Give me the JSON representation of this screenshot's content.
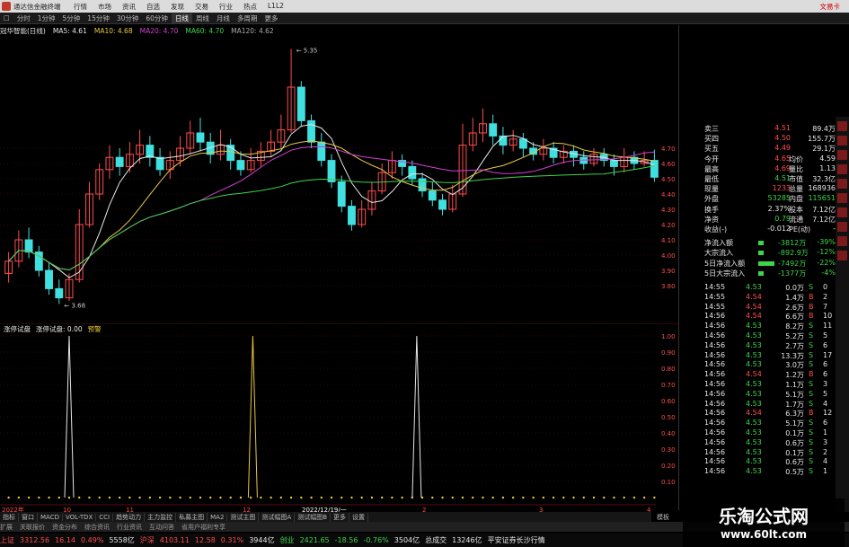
{
  "titlebar": {
    "app_title": "通达信金融终端",
    "menu": [
      "行情",
      "市场",
      "资讯",
      "自选",
      "发现",
      "交易",
      "行业",
      "热点",
      "L1L2"
    ],
    "right": "文易卡"
  },
  "periodbar": {
    "items": [
      "分时",
      "1分钟",
      "5分钟",
      "15分钟",
      "30分钟",
      "60分钟",
      "日线",
      "周线",
      "月线",
      "多周期",
      "更多"
    ],
    "active": "日线"
  },
  "chart_info": {
    "name": "冠华智能(日线)",
    "ma5": "MA5: 4.61",
    "ma10": "MA10: 4.68",
    "ma20": "MA20: 4.70",
    "ma60": "MA60: 4.70",
    "ma120": "MA120: 4.62"
  },
  "kline": {
    "high_label": "5.35",
    "low_label": "3.68",
    "price_ticks": [
      "4.70",
      "4.60",
      "4.50",
      "4.40",
      "4.30",
      "4.20",
      "4.10",
      "4.00",
      "3.90",
      "3.80"
    ]
  },
  "indicator": {
    "title": "涨停试盘",
    "value_label": "涨停试盘: 0.00",
    "extra_label": "预警",
    "ticks": [
      "1.00",
      "0.90",
      "0.80",
      "0.70",
      "0.60",
      "0.50",
      "0.40",
      "0.30",
      "0.20",
      "0.10"
    ],
    "date_labels": [
      "2022年",
      "10",
      "11",
      "12",
      "2022/12/19/一",
      "2",
      "3",
      "4"
    ]
  },
  "quote": {
    "rows": [
      {
        "l": "卖三",
        "v": "4.51",
        "l2": "",
        "v2": "89.4万"
      },
      {
        "l": "买四",
        "v": "4.50",
        "l2": "",
        "v2": "155.7万"
      },
      {
        "l": "买五",
        "v": "4.49",
        "l2": "",
        "v2": "29.1万"
      },
      {
        "l": "今开",
        "v": "4.65",
        "l2": "均价",
        "v2": "4.59"
      },
      {
        "l": "最高",
        "v": "4.69",
        "l2": "量比",
        "v2": "1.13"
      },
      {
        "l": "最低",
        "v": "4.51",
        "l2": "市值",
        "v2": "32.3亿"
      },
      {
        "l": "现量",
        "v": "1233",
        "l2": "总量",
        "v2": "168936"
      },
      {
        "l": "外盘",
        "v": "53285",
        "l2": "内盘",
        "v2": "115651"
      },
      {
        "l": "换手",
        "v": "2.37%",
        "l2": "股本",
        "v2": "7.12亿"
      },
      {
        "l": "净资",
        "v": "0.79",
        "l2": "流通",
        "v2": "7.12亿"
      },
      {
        "l": "收益(-)",
        "v": "-0.012",
        "l2": "PE(动)",
        "v2": "-"
      }
    ],
    "flow": [
      {
        "l": "净流入额",
        "v": "-3812万",
        "p": "-39%"
      },
      {
        "l": "大宗流入",
        "v": "-892.9万",
        "p": "-12%"
      },
      {
        "l": "5日净流入额",
        "v": "-7492万",
        "p": "-22%"
      },
      {
        "l": "5日大宗流入",
        "v": "-1377万",
        "p": "-4%"
      }
    ],
    "ticks": [
      {
        "t": "14:55",
        "p": "4.53",
        "v": "0.0万",
        "s": "S",
        "n": "0"
      },
      {
        "t": "14:55",
        "p": "4.54",
        "v": "1.4万",
        "s": "B",
        "n": "2"
      },
      {
        "t": "14:55",
        "p": "4.54",
        "v": "2.6万",
        "s": "B",
        "n": "7"
      },
      {
        "t": "14:56",
        "p": "4.54",
        "v": "6.6万",
        "s": "B",
        "n": "10"
      },
      {
        "t": "14:56",
        "p": "4.53",
        "v": "8.2万",
        "s": "S",
        "n": "11"
      },
      {
        "t": "14:56",
        "p": "4.53",
        "v": "5.2万",
        "s": "S",
        "n": "5"
      },
      {
        "t": "14:56",
        "p": "4.53",
        "v": "2.7万",
        "s": "S",
        "n": "6"
      },
      {
        "t": "14:56",
        "p": "4.53",
        "v": "13.3万",
        "s": "S",
        "n": "17"
      },
      {
        "t": "14:56",
        "p": "4.53",
        "v": "3.0万",
        "s": "S",
        "n": "6"
      },
      {
        "t": "14:56",
        "p": "4.54",
        "v": "1.2万",
        "s": "B",
        "n": "6"
      },
      {
        "t": "14:56",
        "p": "4.53",
        "v": "1.1万",
        "s": "S",
        "n": "3"
      },
      {
        "t": "14:56",
        "p": "4.53",
        "v": "5.1万",
        "s": "S",
        "n": "5"
      },
      {
        "t": "14:56",
        "p": "4.53",
        "v": "1.7万",
        "s": "S",
        "n": "4"
      },
      {
        "t": "14:56",
        "p": "4.54",
        "v": "6.3万",
        "s": "B",
        "n": "12"
      },
      {
        "t": "14:56",
        "p": "4.53",
        "v": "5.1万",
        "s": "S",
        "n": "6"
      },
      {
        "t": "14:56",
        "p": "4.53",
        "v": "0.1万",
        "s": "S",
        "n": "1"
      },
      {
        "t": "14:56",
        "p": "4.53",
        "v": "0.6万",
        "s": "S",
        "n": "3"
      },
      {
        "t": "14:56",
        "p": "4.53",
        "v": "0.1万",
        "s": "S",
        "n": "2"
      },
      {
        "t": "14:56",
        "p": "4.53",
        "v": "0.6万",
        "s": "S",
        "n": "4"
      },
      {
        "t": "14:56",
        "p": "4.53",
        "v": "0.5万",
        "s": "S",
        "n": "1"
      }
    ]
  },
  "bottombar": {
    "items": [
      "指标",
      "窗口",
      "MACD",
      "VOL-TDX",
      "CCI",
      "趋势动力",
      "主力监控",
      "私募主图",
      "MA2",
      "测试主图",
      "测试幅图A",
      "测试幅图B",
      "更多",
      "设置"
    ],
    "right": "模板"
  },
  "tabbar": {
    "items": [
      "扩展",
      "关联报价",
      "资金分布",
      "综合资讯",
      "行业资讯",
      "互动问答",
      "省用户福利专享"
    ]
  },
  "statusbar": {
    "sh_label": "上证",
    "sh_val": "3312.56",
    "sh_chg": "16.14",
    "sh_pct": "0.49%",
    "sh_amt": "5558亿",
    "hs_label": "沪深",
    "hs_val": "4103.11",
    "hs_chg": "12.58",
    "hs_pct": "0.31%",
    "hs_amt": "3944亿",
    "cy_label": "创业",
    "cy_val": "2421.65",
    "cy_chg": "-18.56",
    "cy_pct": "-0.76%",
    "cy_amt": "3504亿",
    "total_label": "总成交",
    "total_val": "13246亿",
    "news": "平安证券长沙行情"
  },
  "watermark": {
    "line1": "乐淘公式网",
    "line2": "www.60lt.com"
  },
  "chart_data": {
    "type": "candlestick",
    "title": "冠华智能(日线)",
    "ylim": [
      3.6,
      5.4
    ],
    "candles": [
      [
        3.88,
        3.96,
        3.82,
        4.02
      ],
      [
        3.96,
        4.1,
        3.92,
        4.16
      ],
      [
        4.1,
        4.02,
        3.98,
        4.18
      ],
      [
        4.02,
        3.9,
        3.86,
        4.06
      ],
      [
        3.9,
        3.78,
        3.74,
        3.95
      ],
      [
        3.78,
        3.72,
        3.68,
        3.84
      ],
      [
        3.72,
        3.84,
        3.7,
        3.88
      ],
      [
        3.84,
        4.2,
        3.82,
        4.3
      ],
      [
        4.2,
        4.4,
        4.18,
        4.48
      ],
      [
        4.4,
        4.56,
        4.36,
        4.6
      ],
      [
        4.56,
        4.64,
        4.5,
        4.72
      ],
      [
        4.64,
        4.58,
        4.52,
        4.7
      ],
      [
        4.58,
        4.66,
        4.54,
        4.74
      ],
      [
        4.66,
        4.72,
        4.6,
        4.82
      ],
      [
        4.72,
        4.64,
        4.58,
        4.78
      ],
      [
        4.64,
        4.56,
        4.52,
        4.7
      ],
      [
        4.56,
        4.62,
        4.5,
        4.68
      ],
      [
        4.62,
        4.7,
        4.58,
        4.78
      ],
      [
        4.7,
        4.8,
        4.66,
        4.88
      ],
      [
        4.8,
        4.74,
        4.68,
        4.9
      ],
      [
        4.74,
        4.66,
        4.6,
        4.8
      ],
      [
        4.66,
        4.72,
        4.62,
        4.82
      ],
      [
        4.72,
        4.62,
        4.56,
        4.76
      ],
      [
        4.62,
        4.56,
        4.52,
        4.68
      ],
      [
        4.56,
        4.62,
        4.54,
        4.7
      ],
      [
        4.62,
        4.68,
        4.58,
        4.74
      ],
      [
        4.68,
        4.74,
        4.64,
        4.82
      ],
      [
        4.74,
        4.82,
        4.7,
        4.92
      ],
      [
        4.82,
        5.1,
        4.8,
        5.35
      ],
      [
        5.1,
        4.88,
        4.84,
        5.14
      ],
      [
        4.88,
        4.74,
        4.7,
        4.92
      ],
      [
        4.74,
        4.62,
        4.58,
        4.8
      ],
      [
        4.62,
        4.48,
        4.44,
        4.66
      ],
      [
        4.48,
        4.32,
        4.28,
        4.52
      ],
      [
        4.32,
        4.2,
        4.16,
        4.36
      ],
      [
        4.2,
        4.3,
        4.18,
        4.36
      ],
      [
        4.3,
        4.42,
        4.26,
        4.48
      ],
      [
        4.42,
        4.54,
        4.4,
        4.6
      ],
      [
        4.54,
        4.62,
        4.5,
        4.68
      ],
      [
        4.62,
        4.58,
        4.52,
        4.66
      ],
      [
        4.58,
        4.5,
        4.46,
        4.62
      ],
      [
        4.5,
        4.42,
        4.38,
        4.54
      ],
      [
        4.42,
        4.36,
        4.32,
        4.48
      ],
      [
        4.36,
        4.3,
        4.26,
        4.4
      ],
      [
        4.3,
        4.4,
        4.28,
        4.46
      ],
      [
        4.4,
        4.72,
        4.38,
        4.86
      ],
      [
        4.72,
        4.8,
        4.68,
        4.9
      ],
      [
        4.8,
        4.86,
        4.74,
        4.96
      ],
      [
        4.86,
        4.78,
        4.72,
        4.92
      ],
      [
        4.78,
        4.72,
        4.66,
        4.84
      ],
      [
        4.72,
        4.76,
        4.68,
        4.82
      ],
      [
        4.76,
        4.7,
        4.64,
        4.8
      ],
      [
        4.7,
        4.66,
        4.62,
        4.74
      ],
      [
        4.66,
        4.7,
        4.62,
        4.76
      ],
      [
        4.7,
        4.64,
        4.6,
        4.74
      ],
      [
        4.64,
        4.68,
        4.6,
        4.72
      ],
      [
        4.68,
        4.64,
        4.58,
        4.72
      ],
      [
        4.64,
        4.6,
        4.56,
        4.68
      ],
      [
        4.6,
        4.66,
        4.58,
        4.7
      ],
      [
        4.66,
        4.62,
        4.58,
        4.7
      ],
      [
        4.62,
        4.58,
        4.52,
        4.66
      ],
      [
        4.58,
        4.64,
        4.54,
        4.7
      ],
      [
        4.64,
        4.6,
        4.56,
        4.68
      ],
      [
        4.6,
        4.62,
        4.58,
        4.68
      ],
      [
        4.62,
        4.51,
        4.48,
        4.69
      ]
    ],
    "signals": [
      0.1,
      0.38,
      0.63
    ]
  }
}
